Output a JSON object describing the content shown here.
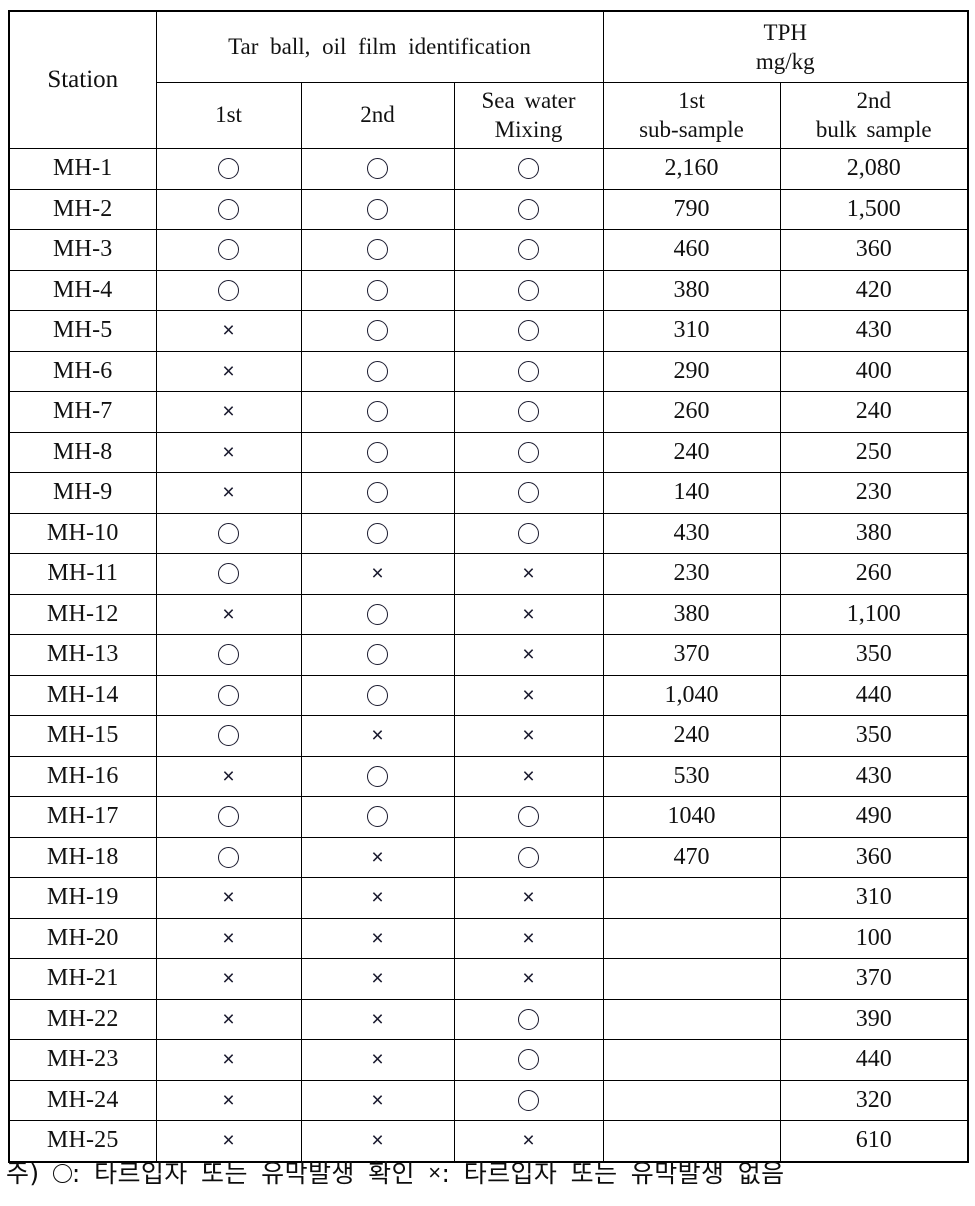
{
  "table": {
    "header": {
      "station": "Station",
      "group_tarball": "Tar  ball,  oil  film  identification",
      "group_tph_line1": "TPH",
      "group_tph_line2": "mg/kg",
      "sub_first": "1st",
      "sub_second": "2nd",
      "sub_sea_line1": "Sea  water",
      "sub_sea_line2": "Mixing",
      "sub_tph1_line1": "1st",
      "sub_tph1_line2": "sub-sample",
      "sub_tph2_line1": "2nd",
      "sub_tph2_line2": "bulk  sample"
    },
    "symbols": {
      "circle": "circle-mark",
      "cross": "×"
    },
    "columns": [
      "Station",
      "1st",
      "2nd",
      "Sea water Mixing",
      "1st sub-sample",
      "2nd bulk sample"
    ],
    "rows": [
      {
        "station": "MH-1",
        "first": "O",
        "second": "O",
        "sea": "O",
        "tph_sub": "2,160",
        "tph_bulk": "2,080"
      },
      {
        "station": "MH-2",
        "first": "O",
        "second": "O",
        "sea": "O",
        "tph_sub": "790",
        "tph_bulk": "1,500"
      },
      {
        "station": "MH-3",
        "first": "O",
        "second": "O",
        "sea": "O",
        "tph_sub": "460",
        "tph_bulk": "360"
      },
      {
        "station": "MH-4",
        "first": "O",
        "second": "O",
        "sea": "O",
        "tph_sub": "380",
        "tph_bulk": "420"
      },
      {
        "station": "MH-5",
        "first": "X",
        "second": "O",
        "sea": "O",
        "tph_sub": "310",
        "tph_bulk": "430"
      },
      {
        "station": "MH-6",
        "first": "X",
        "second": "O",
        "sea": "O",
        "tph_sub": "290",
        "tph_bulk": "400"
      },
      {
        "station": "MH-7",
        "first": "X",
        "second": "O",
        "sea": "O",
        "tph_sub": "260",
        "tph_bulk": "240"
      },
      {
        "station": "MH-8",
        "first": "X",
        "second": "O",
        "sea": "O",
        "tph_sub": "240",
        "tph_bulk": "250"
      },
      {
        "station": "MH-9",
        "first": "X",
        "second": "O",
        "sea": "O",
        "tph_sub": "140",
        "tph_bulk": "230"
      },
      {
        "station": "MH-10",
        "first": "O",
        "second": "O",
        "sea": "O",
        "tph_sub": "430",
        "tph_bulk": "380"
      },
      {
        "station": "MH-11",
        "first": "O",
        "second": "X",
        "sea": "X",
        "tph_sub": "230",
        "tph_bulk": "260"
      },
      {
        "station": "MH-12",
        "first": "X",
        "second": "O",
        "sea": "X",
        "tph_sub": "380",
        "tph_bulk": "1,100"
      },
      {
        "station": "MH-13",
        "first": "O",
        "second": "O",
        "sea": "X",
        "tph_sub": "370",
        "tph_bulk": "350"
      },
      {
        "station": "MH-14",
        "first": "O",
        "second": "O",
        "sea": "X",
        "tph_sub": "1,040",
        "tph_bulk": "440"
      },
      {
        "station": "MH-15",
        "first": "O",
        "second": "X",
        "sea": "X",
        "tph_sub": "240",
        "tph_bulk": "350"
      },
      {
        "station": "MH-16",
        "first": "X",
        "second": "O",
        "sea": "X",
        "tph_sub": "530",
        "tph_bulk": "430"
      },
      {
        "station": "MH-17",
        "first": "O",
        "second": "O",
        "sea": "O",
        "tph_sub": "1040",
        "tph_bulk": "490"
      },
      {
        "station": "MH-18",
        "first": "O",
        "second": "X",
        "sea": "O",
        "tph_sub": "470",
        "tph_bulk": "360"
      },
      {
        "station": "MH-19",
        "first": "X",
        "second": "X",
        "sea": "X",
        "tph_sub": "",
        "tph_bulk": "310"
      },
      {
        "station": "MH-20",
        "first": "X",
        "second": "X",
        "sea": "X",
        "tph_sub": "",
        "tph_bulk": "100"
      },
      {
        "station": "MH-21",
        "first": "X",
        "second": "X",
        "sea": "X",
        "tph_sub": "",
        "tph_bulk": "370"
      },
      {
        "station": "MH-22",
        "first": "X",
        "second": "X",
        "sea": "O",
        "tph_sub": "",
        "tph_bulk": "390"
      },
      {
        "station": "MH-23",
        "first": "X",
        "second": "X",
        "sea": "O",
        "tph_sub": "",
        "tph_bulk": "440"
      },
      {
        "station": "MH-24",
        "first": "X",
        "second": "X",
        "sea": "O",
        "tph_sub": "",
        "tph_bulk": "320"
      },
      {
        "station": "MH-25",
        "first": "X",
        "second": "X",
        "sea": "X",
        "tph_sub": "",
        "tph_bulk": "610"
      }
    ]
  },
  "footnote": {
    "prefix": "주)",
    "circle_meaning": ": 타르입자 또는 유막발생 확인",
    "cross_glyph": "×",
    "cross_meaning": ": 타르입자 또는 유막발생 없음"
  },
  "colors": {
    "border": "#000000",
    "text": "#111111"
  }
}
